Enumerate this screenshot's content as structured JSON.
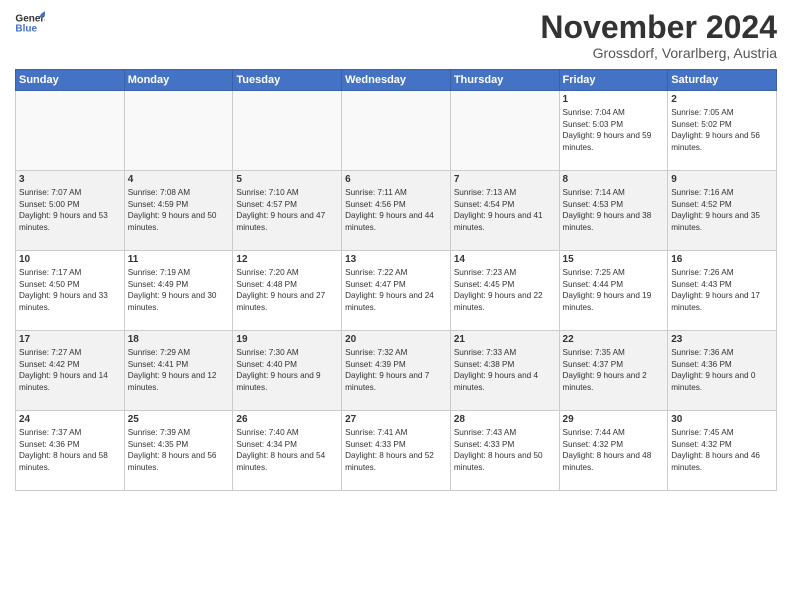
{
  "header": {
    "logo_line1": "General",
    "logo_line2": "Blue",
    "month": "November 2024",
    "location": "Grossdorf, Vorarlberg, Austria"
  },
  "days_of_week": [
    "Sunday",
    "Monday",
    "Tuesday",
    "Wednesday",
    "Thursday",
    "Friday",
    "Saturday"
  ],
  "weeks": [
    [
      {
        "day": "",
        "info": ""
      },
      {
        "day": "",
        "info": ""
      },
      {
        "day": "",
        "info": ""
      },
      {
        "day": "",
        "info": ""
      },
      {
        "day": "",
        "info": ""
      },
      {
        "day": "1",
        "info": "Sunrise: 7:04 AM\nSunset: 5:03 PM\nDaylight: 9 hours and 59 minutes."
      },
      {
        "day": "2",
        "info": "Sunrise: 7:05 AM\nSunset: 5:02 PM\nDaylight: 9 hours and 56 minutes."
      }
    ],
    [
      {
        "day": "3",
        "info": "Sunrise: 7:07 AM\nSunset: 5:00 PM\nDaylight: 9 hours and 53 minutes."
      },
      {
        "day": "4",
        "info": "Sunrise: 7:08 AM\nSunset: 4:59 PM\nDaylight: 9 hours and 50 minutes."
      },
      {
        "day": "5",
        "info": "Sunrise: 7:10 AM\nSunset: 4:57 PM\nDaylight: 9 hours and 47 minutes."
      },
      {
        "day": "6",
        "info": "Sunrise: 7:11 AM\nSunset: 4:56 PM\nDaylight: 9 hours and 44 minutes."
      },
      {
        "day": "7",
        "info": "Sunrise: 7:13 AM\nSunset: 4:54 PM\nDaylight: 9 hours and 41 minutes."
      },
      {
        "day": "8",
        "info": "Sunrise: 7:14 AM\nSunset: 4:53 PM\nDaylight: 9 hours and 38 minutes."
      },
      {
        "day": "9",
        "info": "Sunrise: 7:16 AM\nSunset: 4:52 PM\nDaylight: 9 hours and 35 minutes."
      }
    ],
    [
      {
        "day": "10",
        "info": "Sunrise: 7:17 AM\nSunset: 4:50 PM\nDaylight: 9 hours and 33 minutes."
      },
      {
        "day": "11",
        "info": "Sunrise: 7:19 AM\nSunset: 4:49 PM\nDaylight: 9 hours and 30 minutes."
      },
      {
        "day": "12",
        "info": "Sunrise: 7:20 AM\nSunset: 4:48 PM\nDaylight: 9 hours and 27 minutes."
      },
      {
        "day": "13",
        "info": "Sunrise: 7:22 AM\nSunset: 4:47 PM\nDaylight: 9 hours and 24 minutes."
      },
      {
        "day": "14",
        "info": "Sunrise: 7:23 AM\nSunset: 4:45 PM\nDaylight: 9 hours and 22 minutes."
      },
      {
        "day": "15",
        "info": "Sunrise: 7:25 AM\nSunset: 4:44 PM\nDaylight: 9 hours and 19 minutes."
      },
      {
        "day": "16",
        "info": "Sunrise: 7:26 AM\nSunset: 4:43 PM\nDaylight: 9 hours and 17 minutes."
      }
    ],
    [
      {
        "day": "17",
        "info": "Sunrise: 7:27 AM\nSunset: 4:42 PM\nDaylight: 9 hours and 14 minutes."
      },
      {
        "day": "18",
        "info": "Sunrise: 7:29 AM\nSunset: 4:41 PM\nDaylight: 9 hours and 12 minutes."
      },
      {
        "day": "19",
        "info": "Sunrise: 7:30 AM\nSunset: 4:40 PM\nDaylight: 9 hours and 9 minutes."
      },
      {
        "day": "20",
        "info": "Sunrise: 7:32 AM\nSunset: 4:39 PM\nDaylight: 9 hours and 7 minutes."
      },
      {
        "day": "21",
        "info": "Sunrise: 7:33 AM\nSunset: 4:38 PM\nDaylight: 9 hours and 4 minutes."
      },
      {
        "day": "22",
        "info": "Sunrise: 7:35 AM\nSunset: 4:37 PM\nDaylight: 9 hours and 2 minutes."
      },
      {
        "day": "23",
        "info": "Sunrise: 7:36 AM\nSunset: 4:36 PM\nDaylight: 9 hours and 0 minutes."
      }
    ],
    [
      {
        "day": "24",
        "info": "Sunrise: 7:37 AM\nSunset: 4:36 PM\nDaylight: 8 hours and 58 minutes."
      },
      {
        "day": "25",
        "info": "Sunrise: 7:39 AM\nSunset: 4:35 PM\nDaylight: 8 hours and 56 minutes."
      },
      {
        "day": "26",
        "info": "Sunrise: 7:40 AM\nSunset: 4:34 PM\nDaylight: 8 hours and 54 minutes."
      },
      {
        "day": "27",
        "info": "Sunrise: 7:41 AM\nSunset: 4:33 PM\nDaylight: 8 hours and 52 minutes."
      },
      {
        "day": "28",
        "info": "Sunrise: 7:43 AM\nSunset: 4:33 PM\nDaylight: 8 hours and 50 minutes."
      },
      {
        "day": "29",
        "info": "Sunrise: 7:44 AM\nSunset: 4:32 PM\nDaylight: 8 hours and 48 minutes."
      },
      {
        "day": "30",
        "info": "Sunrise: 7:45 AM\nSunset: 4:32 PM\nDaylight: 8 hours and 46 minutes."
      }
    ]
  ]
}
